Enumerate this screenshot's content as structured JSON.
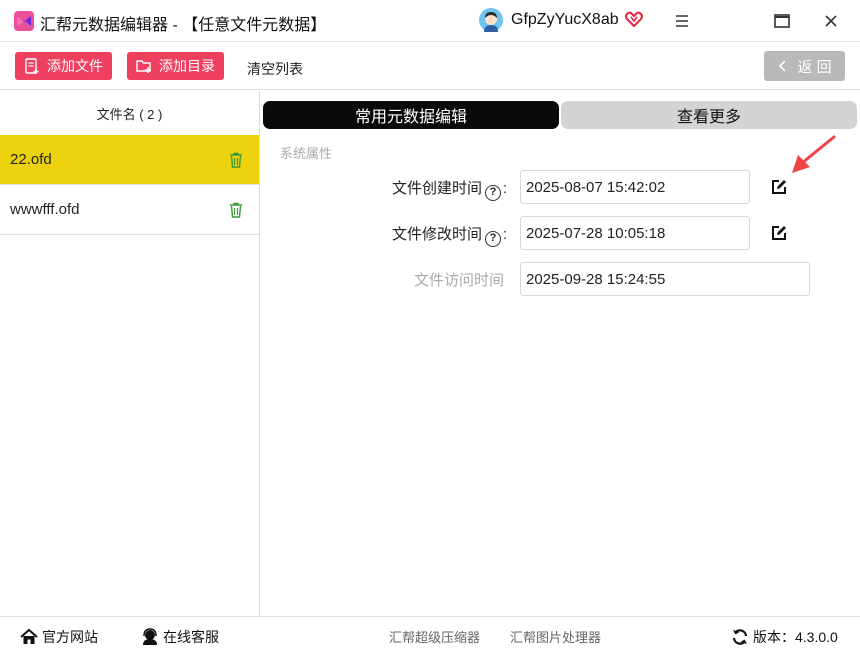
{
  "window": {
    "title": "汇帮元数据编辑器 - 【任意文件元数据】",
    "username": "GfpZyYucX8ab",
    "icons": [
      "app-logo-icon",
      "avatar",
      "vip-heart-icon",
      "menu-icon",
      "maximize-icon",
      "close-icon"
    ],
    "brand_color": "#f0405f"
  },
  "toolbar": {
    "add_file_label": "添加文件",
    "add_dir_label": "添加目录",
    "clear_label": "清空列表",
    "back_label": "返 回"
  },
  "file_list": {
    "header": "文件名 ( 2 )",
    "items": [
      {
        "name": "22.ofd",
        "selected": true
      },
      {
        "name": "wwwfff.ofd",
        "selected": false
      }
    ],
    "selected_color": "#ecd20c"
  },
  "tabs": [
    {
      "label": "常用元数据编辑",
      "active": true
    },
    {
      "label": "查看更多",
      "active": false
    }
  ],
  "system_props": {
    "section_label": "系统属性",
    "created_label": "文件创建时间",
    "created_value": "2025-08-07 15:42:02",
    "modified_label": "文件修改时间",
    "modified_value": "2025-07-28 10:05:18",
    "accessed_label": "文件访问时间",
    "accessed_value": "2025-09-28 15:24:55",
    "help_glyph": "?",
    "colon": ":"
  },
  "statusbar": {
    "website_label": "官方网站",
    "support_label": "在线客服",
    "link1_label": "汇帮超级压缩器",
    "link2_label": "汇帮图片处理器",
    "version_label": "版本：4.3.0.0"
  }
}
